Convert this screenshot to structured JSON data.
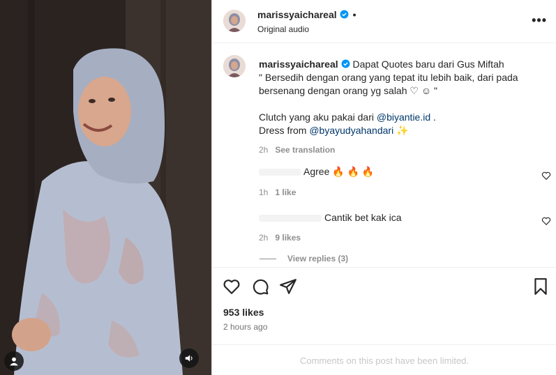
{
  "post": {
    "username": "marissyaichareal",
    "audio_label": "Original audio",
    "caption_lines": {
      "line1": "Dapat Quotes baru dari Gus Miftah",
      "line2": "\" Bersedih dengan orang yang tepat itu lebih baik, dari pada",
      "line3": "bersenang dengan orang yg salah ♡ ☺ \"",
      "line4_prefix": "Clutch yang aku pakai dari ",
      "line4_mention": "@biyantie.id",
      "line4_suffix": " .",
      "line5_prefix": "Dress from ",
      "line5_mention": "@byayudyahandari",
      "line5_emoji": " ✨"
    },
    "caption_time": "2h",
    "see_translation": "See translation"
  },
  "comments": [
    {
      "text": "Agree 🔥 🔥 🔥",
      "time": "1h",
      "likes": "1 like"
    },
    {
      "text": "Cantik bet kak ica",
      "time": "2h",
      "likes": "9 likes",
      "view_replies": "View replies (3)"
    }
  ],
  "footer": {
    "likes": "953 likes",
    "time": "2 hours ago",
    "limited": "Comments on this post have been limited."
  },
  "icons": [
    "heart-icon",
    "comment-icon",
    "share-icon",
    "bookmark-icon",
    "more-icon",
    "verified-icon",
    "user-tag-icon",
    "audio-icon"
  ],
  "colors": {
    "verified": "#0095f6",
    "mention": "#00376b",
    "muted": "#8e8e8e",
    "limited": "#c7c7c7"
  }
}
